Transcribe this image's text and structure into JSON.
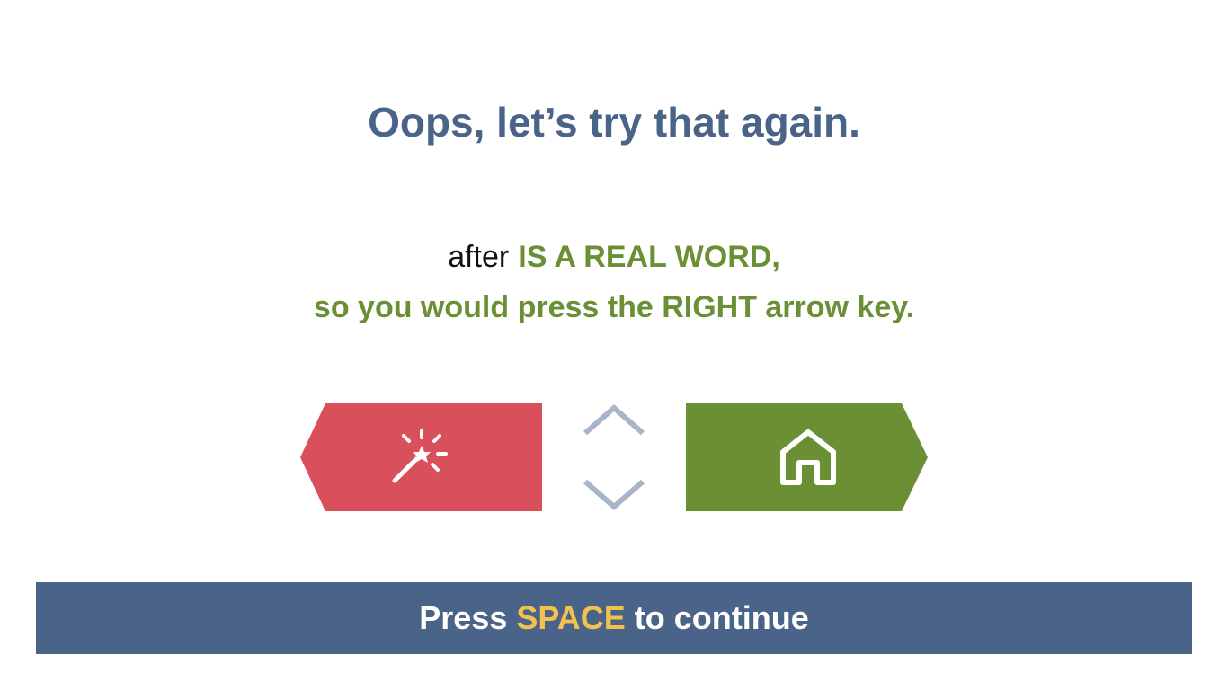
{
  "headline": "Oops, let’s try that again.",
  "feedback": {
    "word": "after",
    "verdict": "IS A REAL WORD,",
    "instruction": "so you would press the RIGHT arrow key."
  },
  "choices": {
    "left": {
      "icon": "magic-wand-icon",
      "color": "#d94f5c"
    },
    "right": {
      "icon": "house-icon",
      "color": "#6a8f35"
    }
  },
  "arrows": {
    "up": "chevron-up-icon",
    "down": "chevron-down-icon",
    "color": "#a8b4c8"
  },
  "continue_bar": {
    "prefix": "Press ",
    "key": "SPACE",
    "suffix": " to continue",
    "background": "#4a6489",
    "key_color": "#f2c14e"
  }
}
